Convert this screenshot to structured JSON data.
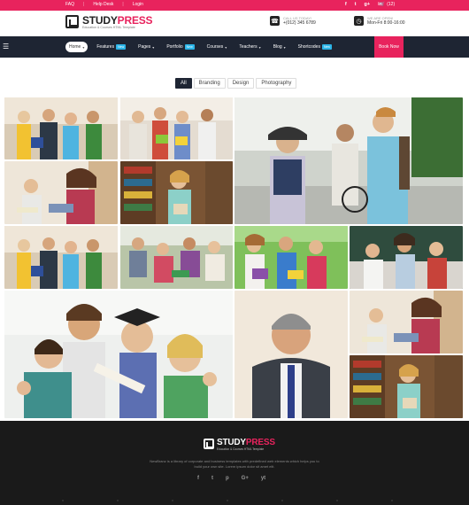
{
  "topbar": {
    "links": [
      "FAQ",
      "Help Desk",
      "Login"
    ],
    "social": [
      "f",
      "t",
      "g+",
      "in"
    ],
    "cart": "(12)",
    "color": "#e8235d"
  },
  "header": {
    "logo_study": "STUDY",
    "logo_press": "PRESS",
    "logo_tagline": "Education & Courses HTML Template",
    "call_label": "CALL US TODAY!",
    "call_value": "+(012) 345 6789",
    "open_label": "WE ARE OPEN!",
    "open_value": "Mon-Fri 8:00-16:00"
  },
  "nav": {
    "items": [
      {
        "label": "Home"
      },
      {
        "label": "Features",
        "badge": "New",
        "badge_color": "#2bb5e8"
      },
      {
        "label": "Pages"
      },
      {
        "label": "Portfolio",
        "badge": "New",
        "badge_color": "#2bb5e8"
      },
      {
        "label": "Courses"
      },
      {
        "label": "Teachers"
      },
      {
        "label": "Blog"
      },
      {
        "label": "Shortcodes",
        "badge": "New",
        "badge_color": "#2bb5e8"
      }
    ],
    "book_now": "Book Now",
    "background": "#1e2533"
  },
  "filters": [
    "All",
    "Branding",
    "Design",
    "Photography"
  ],
  "gallery": [
    {
      "name": "students-group-hallway"
    },
    {
      "name": "students-with-books"
    },
    {
      "name": "students-walking-campus"
    },
    {
      "name": "student-library-reading"
    },
    {
      "name": "student-library-shelves"
    },
    {
      "name": "students-group-hallway-2"
    },
    {
      "name": "students-sitting-outdoors"
    },
    {
      "name": "students-study-group"
    },
    {
      "name": "students-classroom"
    },
    {
      "name": "graduates-selfie"
    },
    {
      "name": "smiling-teacher-portrait"
    },
    {
      "name": "student-library-reading-2"
    },
    {
      "name": "student-library-shelves-2"
    }
  ],
  "footer": {
    "logo_study": "STUDY",
    "logo_press": "PRESS",
    "logo_tagline": "Education & Courses HTML Template",
    "description": "NewBranz is a library of corporate and business templates with predefined web elements which helps you to build your own site. Lorem ipsum dolor sit amet elit.",
    "social": [
      "f",
      "t",
      "p",
      "G+",
      "yt"
    ]
  }
}
